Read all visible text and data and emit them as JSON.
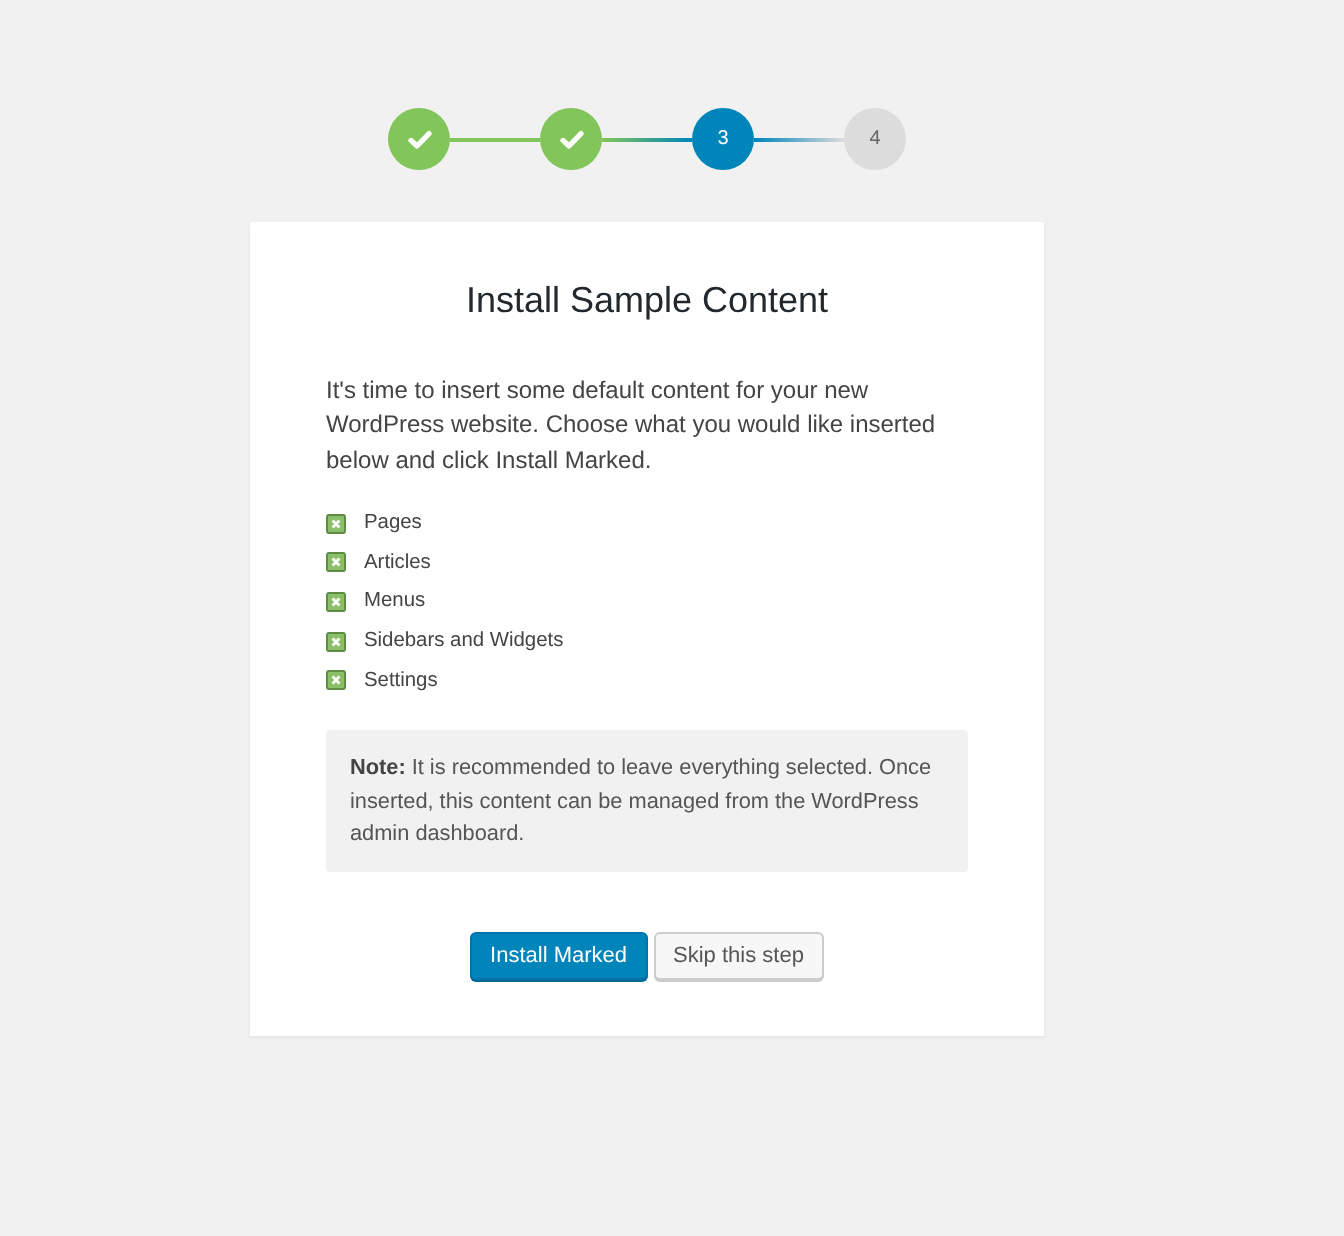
{
  "steps": [
    {
      "kind": "done"
    },
    {
      "kind": "done"
    },
    {
      "kind": "current",
      "label": "3"
    },
    {
      "kind": "upcoming",
      "label": "4"
    }
  ],
  "card": {
    "title": "Install Sample Content",
    "intro": "It's time to insert some default content for your new WordPress website. Choose what you would like inserted below and click Install Marked.",
    "options": [
      {
        "label": "Pages",
        "checked": true
      },
      {
        "label": "Articles",
        "checked": true
      },
      {
        "label": "Menus",
        "checked": true
      },
      {
        "label": "Sidebars and Widgets",
        "checked": true
      },
      {
        "label": "Settings",
        "checked": true
      }
    ],
    "note": "**Note:** It is recommended to leave everything selected. Once inserted, this content can be managed from the WordPress admin dashboard.",
    "buttons": [
      {
        "kind": "primary",
        "label": "Install Marked"
      },
      {
        "kind": "secondary",
        "label": "Skip this step"
      }
    ]
  }
}
